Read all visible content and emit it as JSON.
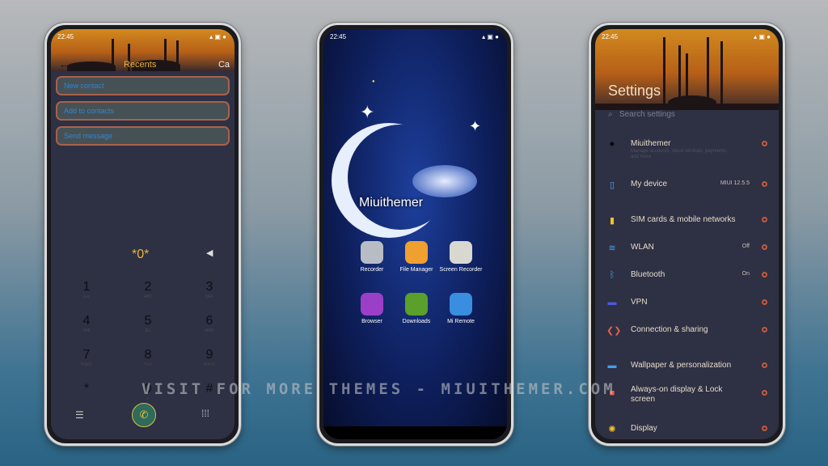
{
  "status_time": "22:45",
  "dialer": {
    "tab_recents": "Recents",
    "tab_contacts": "Ca",
    "back_icon": "arrow-left-icon",
    "actions": [
      "New contact",
      "Add to contacts",
      "Send message"
    ],
    "input": "*0*",
    "keys": [
      {
        "d": "1",
        "l": "o.o"
      },
      {
        "d": "2",
        "l": "ABC"
      },
      {
        "d": "3",
        "l": "DEF"
      },
      {
        "d": "4",
        "l": "GHI"
      },
      {
        "d": "5",
        "l": "JKL"
      },
      {
        "d": "6",
        "l": "MNO"
      },
      {
        "d": "7",
        "l": "PQRS"
      },
      {
        "d": "8",
        "l": "TUV"
      },
      {
        "d": "9",
        "l": "WXYZ"
      },
      {
        "d": "*",
        "l": ","
      },
      {
        "d": "0",
        "l": "+"
      },
      {
        "d": "#",
        "l": ""
      }
    ],
    "colors": {
      "accent": "#e8b33c",
      "link": "#2f86d6",
      "border": "#a9624a"
    }
  },
  "home": {
    "brand": "Miuithemer",
    "apps": [
      {
        "label": "Recorder",
        "color": "#b8bcc4"
      },
      {
        "label": "File Manager",
        "color": "#f0a030"
      },
      {
        "label": "Screen Recorder",
        "color": "#d8d8d0"
      },
      {
        "label": "Browser",
        "color": "#9b3fc8"
      },
      {
        "label": "Downloads",
        "color": "#5aa02a"
      },
      {
        "label": "Mi Remote",
        "color": "#3a8ee0"
      }
    ]
  },
  "settings": {
    "title": "Settings",
    "search_placeholder": "Search settings",
    "items": [
      {
        "label": "Miuithemer",
        "sub": "Manage accounts, cloud services, payments, and more",
        "value": "",
        "icon": "avatar"
      },
      {
        "label": "My device",
        "value": "MIUI 12.5.5",
        "icon": "phone-icon"
      },
      {
        "label": "SIM cards & mobile networks",
        "value": "",
        "icon": "sim-icon"
      },
      {
        "label": "WLAN",
        "value": "Off",
        "icon": "wifi-icon"
      },
      {
        "label": "Bluetooth",
        "value": "On",
        "icon": "bluetooth-icon"
      },
      {
        "label": "VPN",
        "value": "",
        "icon": "vpn-icon"
      },
      {
        "label": "Connection & sharing",
        "value": "",
        "icon": "share-icon"
      },
      {
        "label": "Wallpaper & personalization",
        "value": "",
        "icon": "wallpaper-icon"
      },
      {
        "label": "Always-on display & Lock screen",
        "value": "",
        "icon": "lock-icon"
      },
      {
        "label": "Display",
        "value": "",
        "icon": "sun-icon"
      }
    ]
  },
  "watermark": "VISIT FOR MORE THEMES - MIUITHEMER.COM"
}
